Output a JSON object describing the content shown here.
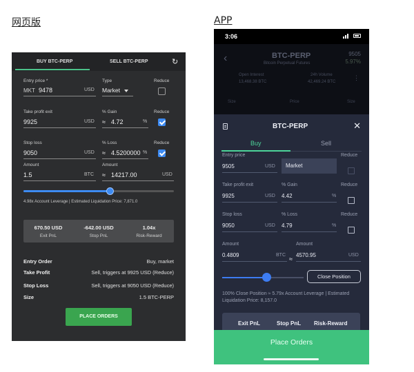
{
  "captions": {
    "web": "网页版",
    "app": "APP"
  },
  "web": {
    "tabs": {
      "buy": "BUY BTC-PERP",
      "sell": "SELL BTC-PERP"
    },
    "entry": {
      "label": "Entry price *",
      "prefix": "MKT",
      "value": "9478",
      "unit": "USD"
    },
    "type": {
      "label": "Type",
      "value": "Market"
    },
    "reduce_label": "Reduce",
    "take_profit": {
      "label": "Take profit exit",
      "value": "9925",
      "unit": "USD"
    },
    "gain": {
      "label": "% Gain",
      "approx": "≈",
      "value": "4.72",
      "unit": "%"
    },
    "stop_loss": {
      "label": "Stop loss",
      "value": "9050",
      "unit": "USD"
    },
    "loss": {
      "label": "% Loss",
      "approx": "≈",
      "value": "4.5200000",
      "unit": "%"
    },
    "amount_btc": {
      "label": "Amount",
      "value": "1.5",
      "unit": "BTC"
    },
    "amount_usd": {
      "label": "Amount",
      "approx": "≈",
      "value": "14217.00",
      "unit": "USD"
    },
    "slider_fraction": 0.58,
    "leverage_text": "4.98x Account Leverage | Estimated Liquidation Price: 7,871.0",
    "pnl": [
      {
        "value": "670.50 USD",
        "label": "Exit PnL"
      },
      {
        "value": "-642.00 USD",
        "label": "Stop PnL"
      },
      {
        "value": "1.04x",
        "label": "Risk-Reward"
      }
    ],
    "summary": [
      {
        "label": "Entry Order",
        "value": "Buy, market"
      },
      {
        "label": "Take Profit",
        "value": "Sell, triggers at 9925 USD (Reduce)"
      },
      {
        "label": "Stop Loss",
        "value": "Sell, triggers at 9050 USD (Reduce)"
      },
      {
        "label": "Size",
        "value": "1.5 BTC-PERP"
      }
    ],
    "place_label": "PLACE ORDERS",
    "checks": {
      "entry_reduce": false,
      "tp_reduce": true,
      "sl_reduce": true
    }
  },
  "app": {
    "time": "3:06",
    "bg": {
      "title": "BTC-PERP",
      "subtitle": "Bitcoin Perpetual Futures",
      "price": "9505",
      "pct": "5.97%",
      "stat1_label": "Open Interest",
      "stat1_value": "13,468.38 BTC",
      "stat2_label": "24h Volume",
      "stat2_value": "42,469.24 BTC",
      "col1": "Size",
      "col2": "Price",
      "col3": "Size"
    },
    "sheet_title": "BTC-PERP",
    "tabs": {
      "buy": "Buy",
      "sell": "Sell"
    },
    "entry": {
      "label": "Entry price",
      "value": "9505",
      "unit": "USD"
    },
    "market": "Market",
    "reduce_label": "Reduce",
    "take_profit": {
      "label": "Take profit exit",
      "value": "9925",
      "unit": "USD"
    },
    "gain": {
      "label": "% Gain",
      "value": "4.42",
      "unit": "%"
    },
    "stop_loss": {
      "label": "Stop loss",
      "value": "9050",
      "unit": "USD"
    },
    "loss": {
      "label": "% Loss",
      "value": "4.79",
      "unit": "%"
    },
    "amount_btc": {
      "label": "Amount",
      "value": "0.4809",
      "unit": "BTC"
    },
    "approx": "≈",
    "amount_usd": {
      "label": "Amount",
      "value": "4570.95",
      "unit": "USD"
    },
    "slider_fraction": 0.55,
    "close_position": "Close Position",
    "leverage_text": "100% Close Position ≈ 5.79x Account Leverage | Estimated Liquidation Price: 8,157.0",
    "pnl": {
      "exit": "Exit PnL",
      "stop": "Stop PnL",
      "rr": "Risk-Reward"
    },
    "place_label": "Place Orders"
  }
}
